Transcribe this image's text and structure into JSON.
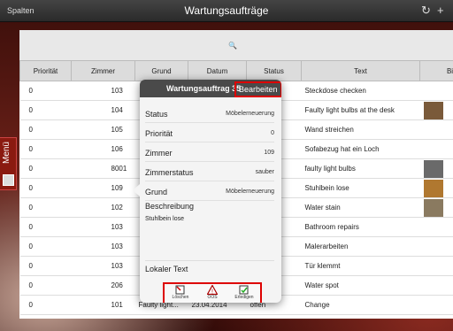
{
  "topbar": {
    "left_label": "Spalten",
    "title": "Wartungsaufträge"
  },
  "side_menu": {
    "label": "Menü"
  },
  "table": {
    "columns": [
      "Priorität",
      "Zimmer",
      "Grund",
      "Datum",
      "Status",
      "Text",
      "Bi"
    ],
    "rows": [
      {
        "prio": "0",
        "zimmer": "103",
        "grund": "",
        "datum": "",
        "status": "",
        "text": "Steckdose checken",
        "thumb": false
      },
      {
        "prio": "0",
        "zimmer": "104",
        "grund": "",
        "datum": "",
        "status": "",
        "text": "Faulty light bulbs at the desk",
        "thumb": true
      },
      {
        "prio": "0",
        "zimmer": "105",
        "grund": "",
        "datum": "",
        "status": "",
        "text": "Wand streichen",
        "thumb": false
      },
      {
        "prio": "0",
        "zimmer": "106",
        "grund": "",
        "datum": "",
        "status": "",
        "text": "Sofabezug hat ein Loch",
        "thumb": false
      },
      {
        "prio": "0",
        "zimmer": "8001",
        "grund": "",
        "datum": "",
        "status": "",
        "text": "faulty light bulbs",
        "thumb": true
      },
      {
        "prio": "0",
        "zimmer": "109",
        "grund": "",
        "datum": "",
        "status": "",
        "text": "Stuhlbein lose",
        "thumb": true
      },
      {
        "prio": "0",
        "zimmer": "102",
        "grund": "",
        "datum": "",
        "status": "sen",
        "text": "Water stain",
        "thumb": true
      },
      {
        "prio": "0",
        "zimmer": "103",
        "grund": "",
        "datum": "",
        "status": "sen",
        "text": "Bathroom repairs",
        "thumb": false
      },
      {
        "prio": "0",
        "zimmer": "103",
        "grund": "",
        "datum": "",
        "status": "",
        "text": "Malerarbeiten",
        "thumb": false
      },
      {
        "prio": "0",
        "zimmer": "103",
        "grund": "",
        "datum": "",
        "status": "",
        "text": "Tür klemmt",
        "thumb": false
      },
      {
        "prio": "0",
        "zimmer": "206",
        "grund": "",
        "datum": "",
        "status": "sen",
        "text": "Water spot",
        "thumb": false
      },
      {
        "prio": "0",
        "zimmer": "101",
        "grund": "Faulty light...",
        "datum": "23.04.2014",
        "status": "offen",
        "text": "Change",
        "thumb": false
      }
    ]
  },
  "popover": {
    "title": "Wartungsauftrag 35",
    "edit_label": "Bearbeiten",
    "fields": [
      {
        "key": "Status",
        "value": "Möbelerneuerung"
      },
      {
        "key": "Priorität",
        "value": "0"
      },
      {
        "key": "Zimmer",
        "value": "109"
      },
      {
        "key": "Zimmerstatus",
        "value": "sauber"
      },
      {
        "key": "Grund",
        "value": "Möbelerneuerung"
      }
    ],
    "description_label": "Beschreibung",
    "description_value": "Stuhlbein lose",
    "local_text_label": "Lokaler Text",
    "actions": [
      {
        "label": "Löschen",
        "icon": "delete-icon"
      },
      {
        "label": "OOS",
        "icon": "warning-icon"
      },
      {
        "label": "Erledigen",
        "icon": "done-icon"
      }
    ]
  }
}
